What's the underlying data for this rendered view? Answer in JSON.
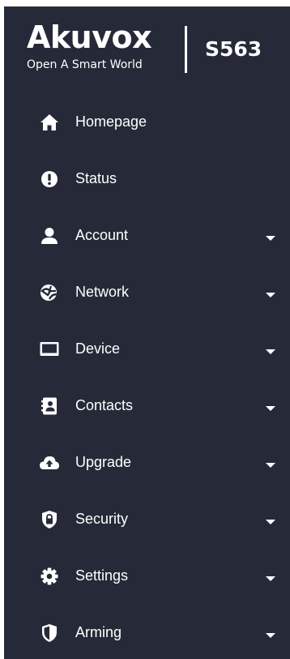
{
  "brand": {
    "logo": "Akuvox",
    "tagline": "Open A Smart World",
    "model": "S563"
  },
  "colors": {
    "sidebar_bg": "#262a38",
    "text": "#ffffff"
  },
  "menu": [
    {
      "label": "Homepage",
      "icon": "home-icon",
      "expandable": false
    },
    {
      "label": "Status",
      "icon": "status-icon",
      "expandable": false
    },
    {
      "label": "Account",
      "icon": "account-icon",
      "expandable": true
    },
    {
      "label": "Network",
      "icon": "network-icon",
      "expandable": true
    },
    {
      "label": "Device",
      "icon": "device-icon",
      "expandable": true
    },
    {
      "label": "Contacts",
      "icon": "contacts-icon",
      "expandable": true
    },
    {
      "label": "Upgrade",
      "icon": "upgrade-icon",
      "expandable": true
    },
    {
      "label": "Security",
      "icon": "security-icon",
      "expandable": true
    },
    {
      "label": "Settings",
      "icon": "settings-icon",
      "expandable": true
    },
    {
      "label": "Arming",
      "icon": "arming-icon",
      "expandable": true
    }
  ]
}
